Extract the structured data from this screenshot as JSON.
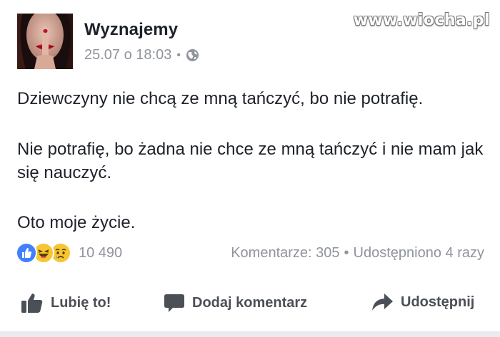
{
  "post": {
    "author": "Wyznajemy",
    "timestamp": "25.07 o 18:03",
    "separator": "•",
    "privacy_icon": "globe-icon",
    "avatar_icon": "avatar-image",
    "watermark": "www.wiocha.pl",
    "paragraphs": [
      "Dziewczyny nie chcą ze mną tańczyć, bo nie potrafię.",
      "Nie potrafię, bo żadna nie chce ze mną tańczyć i nie mam jak się nauczyć.",
      "Oto moje życie."
    ]
  },
  "engagement": {
    "reaction_icons": [
      "like-reaction-icon",
      "haha-reaction-icon",
      "sad-reaction-icon"
    ],
    "reaction_count": "10 490",
    "comments": "Komentarze: 305",
    "separator": "•",
    "shares": "Udostępniono 4 razy"
  },
  "actions": {
    "like": "Lubię to!",
    "comment": "Dodaj komentarz",
    "share": "Udostępnij"
  },
  "colors": {
    "text": "#1d2129",
    "muted": "#90949c",
    "action": "#4b4f56",
    "like_blue": "#4080ff",
    "emoji_yellow": "#f7c531"
  }
}
